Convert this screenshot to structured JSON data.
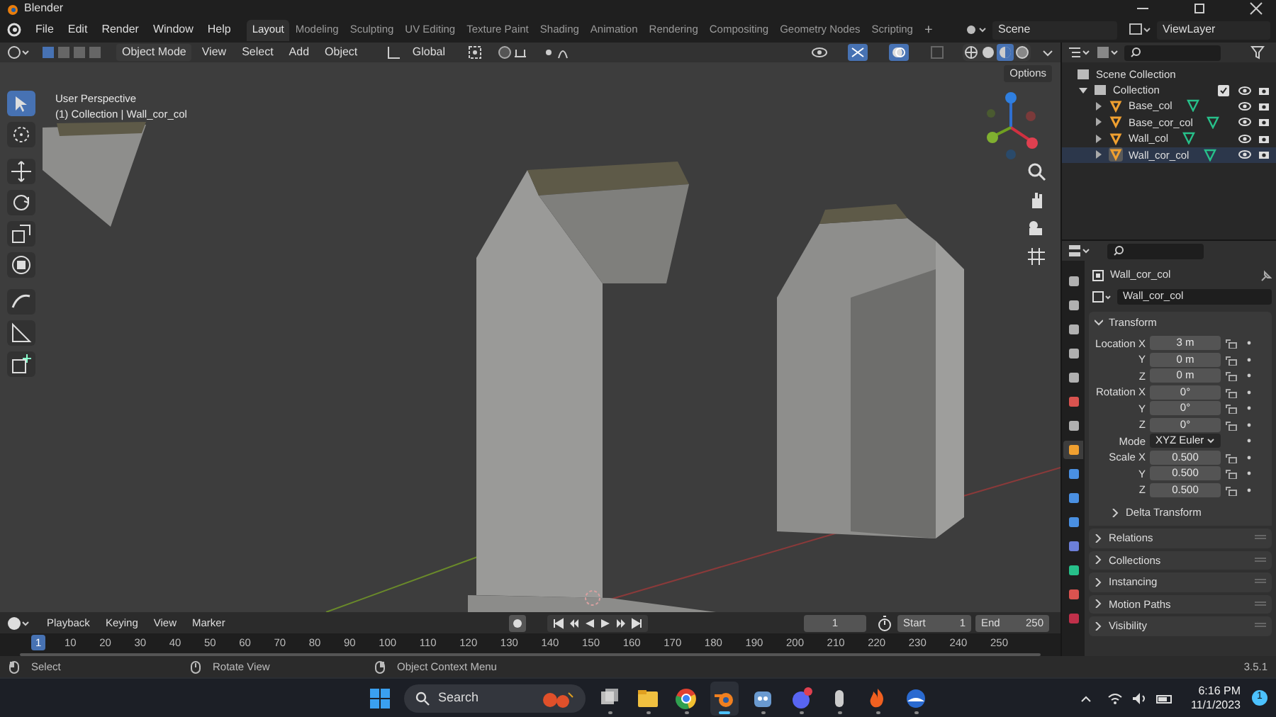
{
  "title_bar": {
    "title": "Blender"
  },
  "menu": [
    "File",
    "Edit",
    "Render",
    "Window",
    "Help"
  ],
  "workspace_tabs": [
    {
      "label": "Layout",
      "selected": true
    },
    {
      "label": "Modeling",
      "selected": false
    },
    {
      "label": "Sculpting",
      "selected": false
    },
    {
      "label": "UV Editing",
      "selected": false
    },
    {
      "label": "Texture Paint",
      "selected": false
    },
    {
      "label": "Shading",
      "selected": false
    },
    {
      "label": "Animation",
      "selected": false
    },
    {
      "label": "Rendering",
      "selected": false
    },
    {
      "label": "Compositing",
      "selected": false
    },
    {
      "label": "Geometry Nodes",
      "selected": false
    },
    {
      "label": "Scripting",
      "selected": false
    }
  ],
  "add_tab": "+",
  "scene": "Scene",
  "view_layer": "ViewLayer",
  "viewport_header": {
    "mode": "Object Mode",
    "menus": [
      "View",
      "Select",
      "Add",
      "Object"
    ],
    "orientation": "Global",
    "gizmos_on": true,
    "overlays_on": true,
    "shading_modes": [
      {
        "selected": false
      },
      {
        "selected": false
      },
      {
        "selected": true
      },
      {
        "selected": false
      }
    ],
    "options": "Options"
  },
  "viewport": {
    "perspective": "User Perspective",
    "context": "(1) Collection | Wall_cor_col",
    "tools": [
      {
        "selected": true
      },
      {
        "selected": false
      },
      {
        "selected": false
      },
      {
        "selected": false
      },
      {
        "selected": false
      },
      {
        "selected": false
      },
      {
        "selected": false
      },
      {
        "selected": false
      },
      {
        "selected": false
      }
    ]
  },
  "outliner": {
    "root": "Scene Collection",
    "collections": [
      {
        "label": "Collection",
        "checked": true,
        "expanded": true,
        "children": [
          {
            "label": "Base_col",
            "selected": false
          },
          {
            "label": "Base_cor_col",
            "selected": false
          },
          {
            "label": "Wall_col",
            "selected": false
          },
          {
            "label": "Wall_cor_col",
            "selected": true
          }
        ]
      }
    ]
  },
  "properties": {
    "object_name": "Wall_cor_col",
    "data_name": "Wall_cor_col",
    "tabs": [
      {
        "selected": false,
        "color": "#b0b0b0"
      },
      {
        "selected": false,
        "color": "#b0b0b0"
      },
      {
        "selected": false,
        "color": "#b0b0b0"
      },
      {
        "selected": false,
        "color": "#b0b0b0"
      },
      {
        "selected": false,
        "color": "#b0b0b0"
      },
      {
        "selected": false,
        "color": "#d9534f"
      },
      {
        "selected": false,
        "color": "#b0b0b0"
      },
      {
        "selected": true,
        "color": "#f0a030"
      },
      {
        "selected": false,
        "color": "#4a90e2"
      },
      {
        "selected": false,
        "color": "#4a90e2"
      },
      {
        "selected": false,
        "color": "#4a90e2"
      },
      {
        "selected": false,
        "color": "#6c7fd8"
      },
      {
        "selected": false,
        "color": "#27c08a"
      },
      {
        "selected": false,
        "color": "#d9534f"
      },
      {
        "selected": false,
        "color": "#c0304a"
      }
    ],
    "transform": {
      "title": "Transform",
      "expanded": true,
      "rows": [
        {
          "kind": "number",
          "label": "Location X",
          "value": "3 m"
        },
        {
          "kind": "number",
          "label": "Y",
          "value": "0 m"
        },
        {
          "kind": "number",
          "label": "Z",
          "value": "0 m"
        },
        {
          "kind": "number",
          "label": "Rotation X",
          "value": "0°"
        },
        {
          "kind": "number",
          "label": "Y",
          "value": "0°"
        },
        {
          "kind": "number",
          "label": "Z",
          "value": "0°"
        },
        {
          "kind": "dropdown",
          "label": "Mode",
          "value": "XYZ Euler"
        },
        {
          "kind": "number",
          "label": "Scale X",
          "value": "0.500"
        },
        {
          "kind": "number",
          "label": "Y",
          "value": "0.500"
        },
        {
          "kind": "number",
          "label": "Z",
          "value": "0.500"
        }
      ],
      "subpanel": "Delta Transform"
    },
    "panels": [
      {
        "title": "Relations",
        "expanded": false
      },
      {
        "title": "Collections",
        "expanded": false
      },
      {
        "title": "Instancing",
        "expanded": false
      },
      {
        "title": "Motion Paths",
        "expanded": false
      },
      {
        "title": "Visibility",
        "expanded": false
      }
    ]
  },
  "timeline": {
    "menus": [
      "Playback",
      "Keying",
      "View",
      "Marker"
    ],
    "current_frame": "1",
    "start_label": "Start",
    "start": "1",
    "end_label": "End",
    "end": "250",
    "ticks": [
      {
        "label": "1",
        "selected": true
      },
      {
        "label": "10",
        "selected": false
      },
      {
        "label": "20",
        "selected": false
      },
      {
        "label": "30",
        "selected": false
      },
      {
        "label": "40",
        "selected": false
      },
      {
        "label": "50",
        "selected": false
      },
      {
        "label": "60",
        "selected": false
      },
      {
        "label": "70",
        "selected": false
      },
      {
        "label": "80",
        "selected": false
      },
      {
        "label": "90",
        "selected": false
      },
      {
        "label": "100",
        "selected": false
      },
      {
        "label": "110",
        "selected": false
      },
      {
        "label": "120",
        "selected": false
      },
      {
        "label": "130",
        "selected": false
      },
      {
        "label": "140",
        "selected": false
      },
      {
        "label": "150",
        "selected": false
      },
      {
        "label": "160",
        "selected": false
      },
      {
        "label": "170",
        "selected": false
      },
      {
        "label": "180",
        "selected": false
      },
      {
        "label": "190",
        "selected": false
      },
      {
        "label": "200",
        "selected": false
      },
      {
        "label": "210",
        "selected": false
      },
      {
        "label": "220",
        "selected": false
      },
      {
        "label": "230",
        "selected": false
      },
      {
        "label": "240",
        "selected": false
      },
      {
        "label": "250",
        "selected": false
      }
    ]
  },
  "status_bar": {
    "hints": [
      "Select",
      "Rotate View",
      "Object Context Menu"
    ],
    "version": "3.5.1"
  },
  "taskbar": {
    "search_placeholder": "Search",
    "apps": [
      {
        "selected": false
      },
      {
        "selected": false
      },
      {
        "selected": false
      },
      {
        "selected": true
      },
      {
        "selected": false
      },
      {
        "selected": false
      },
      {
        "selected": false
      },
      {
        "selected": false
      },
      {
        "selected": false
      }
    ],
    "time": "6:16 PM",
    "date": "11/1/2023",
    "notifications": "1"
  }
}
